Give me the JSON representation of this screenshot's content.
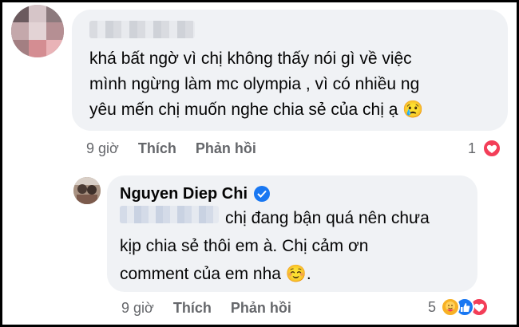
{
  "comment1": {
    "text": "khá bất ngờ vì chị không thấy nói gì về việc\nmình ngừng làm mc olympia , vì có nhiều ng\nyêu mến chị muốn nghe chia sẻ của chị ạ 😢",
    "time": "9 giờ",
    "like_label": "Thích",
    "reply_label": "Phản hồi",
    "reaction_count": "1"
  },
  "comment2": {
    "author": "Nguyen Diep Chi",
    "text": "chị đang bận quá nên chưa\nkịp chia sẻ thôi em à. Chị cảm ơn\ncomment của em nha ☺️.",
    "time": "9 giờ",
    "like_label": "Thích",
    "reply_label": "Phản hồi",
    "reaction_count": "5"
  },
  "icons": {
    "heart": "heart-icon",
    "like": "like-icon",
    "care": "care-icon",
    "verified": "verified-badge-icon"
  },
  "colors": {
    "bubble": "#f0f2f5",
    "meta": "#65676b",
    "heart": "#f33e58",
    "like": "#1877f2",
    "care": "#f7b125"
  }
}
